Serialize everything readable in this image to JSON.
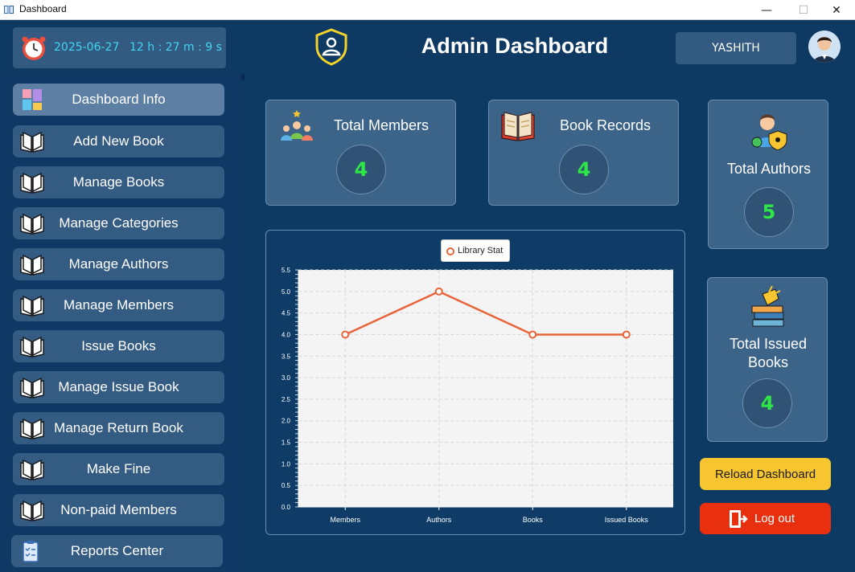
{
  "window": {
    "title": "Dashboard",
    "minimize": "—",
    "maximize": "☐",
    "close": "✕"
  },
  "header": {
    "date": "2025-06-27",
    "time": "12 h : 27 m : 9 s",
    "title": "Admin Dashboard",
    "user": "YASHITH"
  },
  "sidebar": {
    "items": [
      {
        "label": "Dashboard Info",
        "icon": "dashboard-tiles-icon",
        "active": true
      },
      {
        "label": "Add New Book",
        "icon": "book-icon"
      },
      {
        "label": "Manage Books",
        "icon": "book-icon"
      },
      {
        "label": "Manage Categories",
        "icon": "book-icon"
      },
      {
        "label": "Manage Authors",
        "icon": "book-icon"
      },
      {
        "label": "Manage Members",
        "icon": "book-icon"
      },
      {
        "label": "Issue Books",
        "icon": "book-icon"
      },
      {
        "label": "Manage Issue Book",
        "icon": "book-icon"
      },
      {
        "label": "Manage Return Book",
        "icon": "book-icon"
      },
      {
        "label": "Make Fine",
        "icon": "book-icon"
      },
      {
        "label": "Non-paid Members",
        "icon": "book-icon"
      },
      {
        "label": "Reports Center",
        "icon": "clipboard-icon"
      }
    ]
  },
  "cards": {
    "members": {
      "title": "Total Members",
      "value": "4"
    },
    "books": {
      "title": "Book Records",
      "value": "4"
    },
    "authors": {
      "title": "Total Authors",
      "value": "5"
    },
    "issued": {
      "title_line1": "Total Issued",
      "title_line2": "Books",
      "value": "4"
    }
  },
  "buttons": {
    "reload": "Reload Dashboard",
    "logout": "Log out"
  },
  "colors": {
    "accent_value": "#2ee646",
    "line": "#e8643a",
    "reload": "#f7c52f",
    "logout": "#e8300f"
  },
  "chart_data": {
    "type": "line",
    "categories": [
      "Members",
      "Authors",
      "Books",
      "Issued Books"
    ],
    "series": [
      {
        "name": "Library Stat",
        "values": [
          4,
          5,
          4,
          4
        ]
      }
    ],
    "ylim": [
      0,
      5.5
    ],
    "yticks": [
      "0.0",
      "0.5",
      "1.0",
      "1.5",
      "2.0",
      "2.5",
      "3.0",
      "3.5",
      "4.0",
      "4.5",
      "5.0",
      "5.5"
    ],
    "grid": true,
    "legend": "top-center"
  }
}
